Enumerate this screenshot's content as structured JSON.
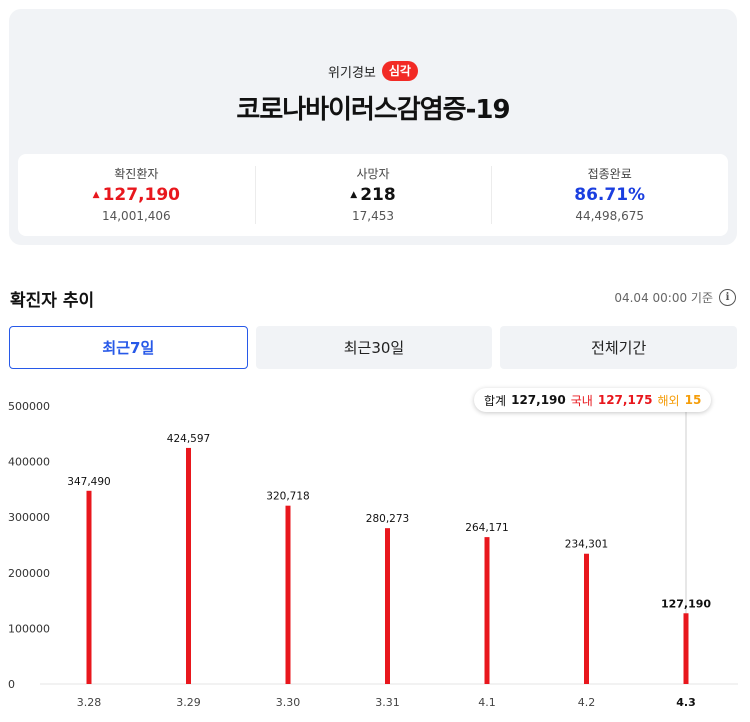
{
  "header": {
    "alert_label": "위기경보",
    "alert_level": "심각",
    "title": "코로나바이러스감염증-19"
  },
  "stats": [
    {
      "label": "확진환자",
      "value": "127,190",
      "arrow": "▲",
      "total": "14,001,406",
      "color": "#e8171d"
    },
    {
      "label": "사망자",
      "value": "218",
      "arrow": "▲",
      "total": "17,453",
      "color": "#111111"
    },
    {
      "label": "접종완료",
      "value": "86.71%",
      "arrow": "",
      "total": "44,498,675",
      "color": "#1b3fe0"
    }
  ],
  "section": {
    "title": "확진자 추이",
    "as_of": "04.04 00:00 기준",
    "info_icon": "info-icon"
  },
  "tabs": [
    "최근7일",
    "최근30일",
    "전체기간"
  ],
  "active_tab": 0,
  "tooltip": {
    "total_label": "합계",
    "total_value": "127,190",
    "domestic_label": "국내",
    "domestic_value": "127,175",
    "overseas_label": "해외",
    "overseas_value": "15"
  },
  "chart_data": {
    "type": "bar",
    "categories": [
      "3.28",
      "3.29",
      "3.30",
      "3.31",
      "4.1",
      "4.2",
      "4.3"
    ],
    "values": [
      347490,
      424597,
      320718,
      280273,
      264171,
      234301,
      127190
    ],
    "value_labels": [
      "347,490",
      "424,597",
      "320,718",
      "280,273",
      "264,171",
      "234,301",
      "127,190"
    ],
    "yticks": [
      "0",
      "100000",
      "200000",
      "300000",
      "400000",
      "500000"
    ],
    "ylim": [
      0,
      500000
    ],
    "highlight_index": 6,
    "bar_color": "#e8171d",
    "grid": false,
    "title": "",
    "xlabel": "",
    "ylabel": ""
  }
}
